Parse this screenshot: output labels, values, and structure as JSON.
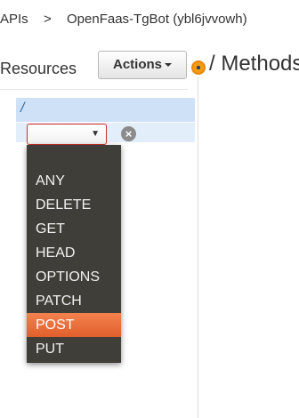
{
  "breadcrumb": {
    "apis": "APIs",
    "separator": ">",
    "api_name": "OpenFaas-TgBot (ybl6jvvowh)"
  },
  "resources": {
    "title": "Resources",
    "actions_label": "Actions",
    "root_path": "/"
  },
  "methods": {
    "title": "/ Methods"
  },
  "method_select": {
    "value": "",
    "cancel_glyph": "×",
    "options": [
      "ANY",
      "DELETE",
      "GET",
      "HEAD",
      "OPTIONS",
      "PATCH",
      "POST",
      "PUT"
    ],
    "highlighted": "POST"
  },
  "colors": {
    "accent_orange": "#e8703a",
    "root_highlight": "#cfe1f7",
    "dropdown_bg": "#3f3e39",
    "error_border": "#c9302c"
  },
  "icons": {
    "splitter": "splitter-handle-icon",
    "cancel": "cancel-icon",
    "dropdown_caret": "chevron-down-icon"
  }
}
